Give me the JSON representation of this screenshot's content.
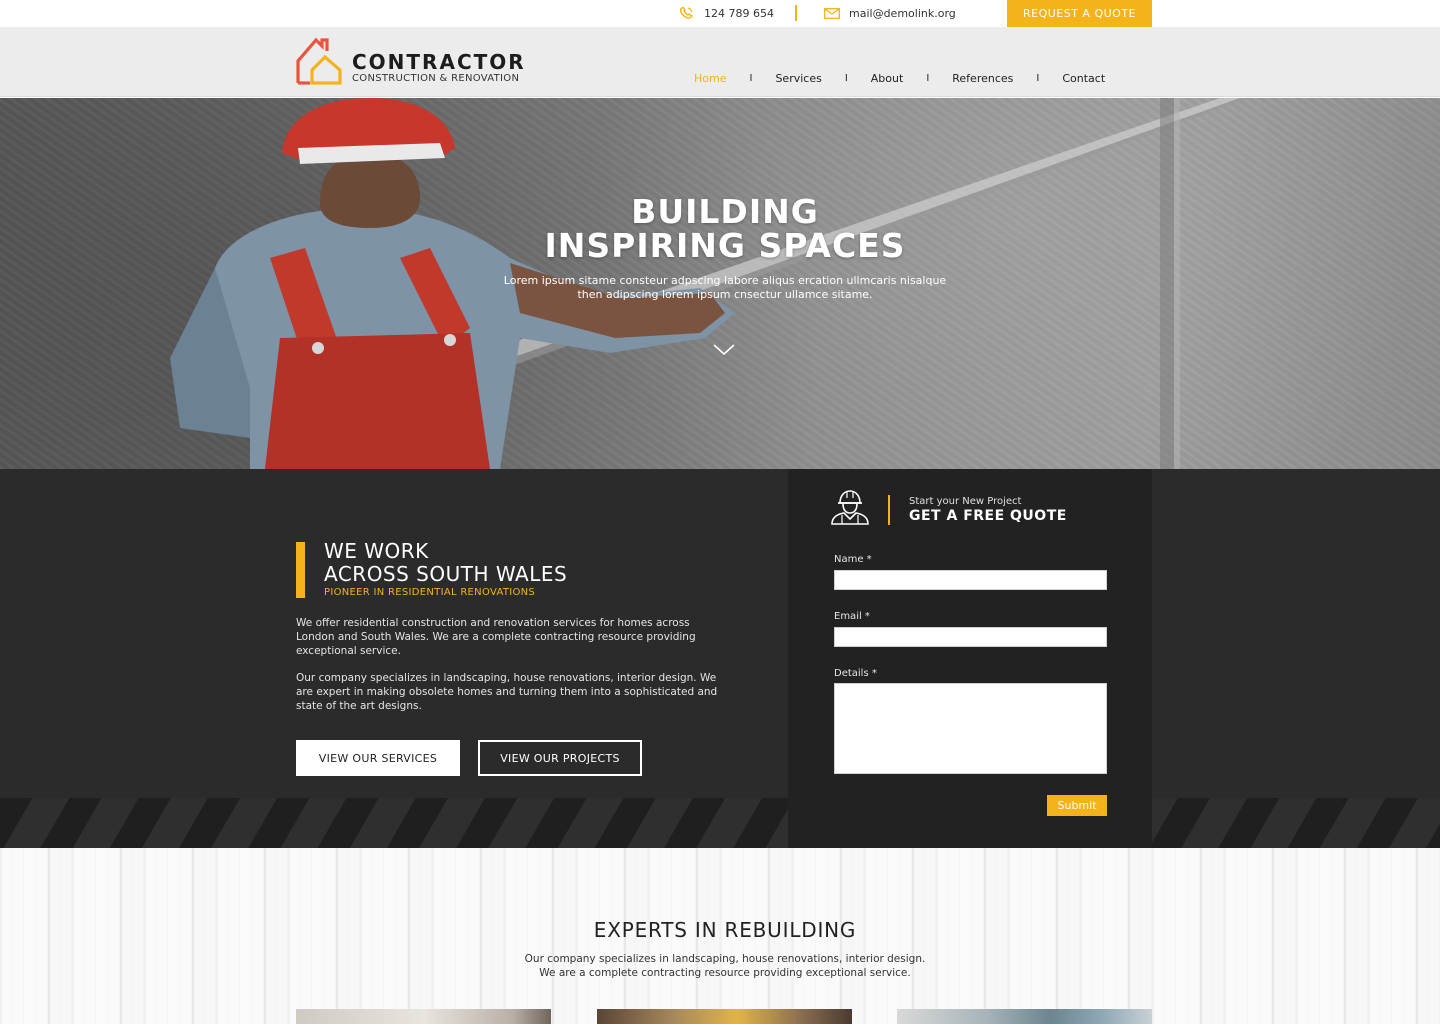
{
  "topbar": {
    "phone": "124 789 654",
    "email": "mail@demolink.org",
    "quote_button": "REQUEST A QUOTE"
  },
  "header": {
    "brand": "CONTRACTOR",
    "tagline": "CONSTRUCTION & RENOVATION",
    "nav": [
      {
        "label": "Home",
        "active": true
      },
      {
        "label": "Services",
        "active": false
      },
      {
        "label": "About",
        "active": false
      },
      {
        "label": "References",
        "active": false
      },
      {
        "label": "Contact",
        "active": false
      }
    ],
    "separator": "I"
  },
  "hero": {
    "title_line1": "BUILDING",
    "title_line2": "INSPIRING SPACES",
    "subtitle_line1": "Lorem ipsum sitame consteur adpscing labore aliqus ercation ullmcaris nisalque",
    "subtitle_line2": "then adipscing lorem ipsum cnsectur ullamce sitame."
  },
  "intro": {
    "heading_line1": "WE WORK",
    "heading_line2": "ACROSS SOUTH WALES",
    "kicker": "PIONEER IN RESIDENTIAL RENOVATIONS",
    "paragraph1": "We offer residential construction and renovation services for homes across London and South Wales. We are a complete contracting resource providing exceptional service.",
    "paragraph2": "Our company specializes in landscaping, house renovations, interior design. We are expert in making obsolete homes and turning them into a sophisticated and state of the art designs.",
    "button_services": "VIEW OUR SERVICES",
    "button_projects": "VIEW OUR PROJECTS"
  },
  "quote_form": {
    "small_title": "Start your New Project",
    "big_title": "GET A FREE QUOTE",
    "name_label": "Name *",
    "name_value": "",
    "email_label": "Email *",
    "email_value": "",
    "details_label": "Details *",
    "details_value": "",
    "submit_label": "Submit"
  },
  "experts": {
    "heading": "EXPERTS IN REBUILDING",
    "line1": "Our company specializes in landscaping, house renovations, interior design.",
    "line2": "We are a complete contracting resource providing exceptional service."
  },
  "colors": {
    "accent": "#f5b31b",
    "dark_bg": "#2b2b2b",
    "panel_bg": "#222222",
    "logo_red": "#e8553f"
  },
  "icons": [
    "phone-icon",
    "mail-icon",
    "house-logo-icon",
    "chevron-down-icon",
    "worker-helmet-icon"
  ]
}
